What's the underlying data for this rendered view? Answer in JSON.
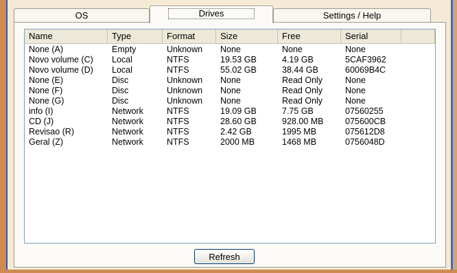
{
  "tabs": [
    {
      "label": "OS"
    },
    {
      "label": "Drives"
    },
    {
      "label": "Settings / Help"
    }
  ],
  "drives_table": {
    "columns": [
      "Name",
      "Type",
      "Format",
      "Size",
      "Free",
      "Serial"
    ],
    "rows": [
      [
        "None (A)",
        "Empty",
        "Unknown",
        "None",
        "None",
        "None"
      ],
      [
        "Novo volume (C)",
        "Local",
        "NTFS",
        "19.53 GB",
        "4.19 GB",
        "5CAF3962"
      ],
      [
        "Novo volume (D)",
        "Local",
        "NTFS",
        "55.02 GB",
        "38.44 GB",
        "60069B4C"
      ],
      [
        "None (E)",
        "Disc",
        "Unknown",
        "None",
        "Read Only",
        "None"
      ],
      [
        "None (F)",
        "Disc",
        "Unknown",
        "None",
        "Read Only",
        "None"
      ],
      [
        "None (G)",
        "Disc",
        "Unknown",
        "None",
        "Read Only",
        "None"
      ],
      [
        "info (I)",
        "Network",
        "NTFS",
        "19.09 GB",
        "7.75 GB",
        "07560255"
      ],
      [
        "CD (J)",
        "Network",
        "NTFS",
        "28.60 GB",
        "928.00 MB",
        "075600CB"
      ],
      [
        "Revisao (R)",
        "Network",
        "NTFS",
        "2.42 GB",
        "1995 MB",
        "075612D8"
      ],
      [
        "Geral (Z)",
        "Network",
        "NTFS",
        "2000 MB",
        "1468 MB",
        "0756048D"
      ]
    ]
  },
  "refresh_label": "Refresh"
}
